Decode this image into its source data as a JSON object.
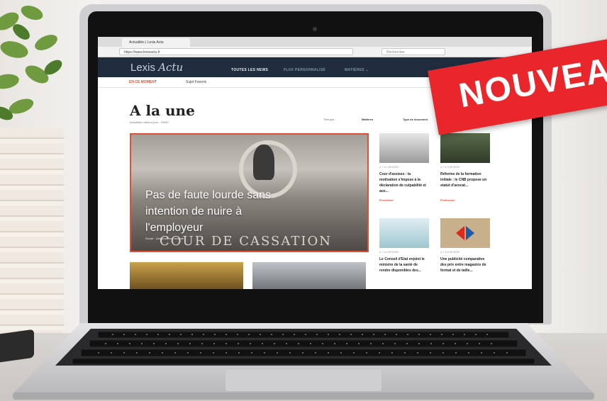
{
  "browser": {
    "tab_title": "Actualités | Lexis Actu",
    "url": "https://www.lexisactu.fr",
    "search_placeholder": "Rechercher"
  },
  "site": {
    "logo_main": "Lexis",
    "logo_accent": "Actu",
    "nav": [
      "TOUTES LES NEWS",
      "FLUX PERSONNALISÉ",
      "MATIÈRES ⌄"
    ],
    "subnav": [
      "EN CE MOMENT",
      "Sujet Favoris"
    ]
  },
  "page": {
    "title": "A la une",
    "subtitle": "Actualités mises à jour : 10h00",
    "filters": [
      "Trier par :",
      "Matières",
      "Type de document"
    ]
  },
  "hero": {
    "title": "Pas de faute lourde sans intention de nuire à l'employeur",
    "inscription": "COUR DE CASSATION",
    "meta": "Social · Jurisprudence récente"
  },
  "cards": [
    {
      "meta": "IL Y A 2 HEURES",
      "text": "Cour d'assises : la motivation s'impose à la déclaration de culpabilité et aux...",
      "tag": "Procédure"
    },
    {
      "meta": "IL Y A 3 HEURES",
      "text": "Réforme de la formation initiale : le CNB propose un statut d'avocat...",
      "tag": "Profession"
    },
    {
      "meta": "IL Y A 4 HEURES",
      "text": "Le Conseil d'Etat enjoint le ministre de la santé de rendre disponibles des...",
      "tag": ""
    },
    {
      "meta": "IL Y A 5 HEURES",
      "text": "Une publicité comparative des prix entre magasins de format et de taille...",
      "tag": ""
    }
  ],
  "banner": {
    "text": "NOUVEAU"
  },
  "colors": {
    "header": "#1f2d3f",
    "accent": "#e24f33",
    "banner": "#e8262b"
  }
}
